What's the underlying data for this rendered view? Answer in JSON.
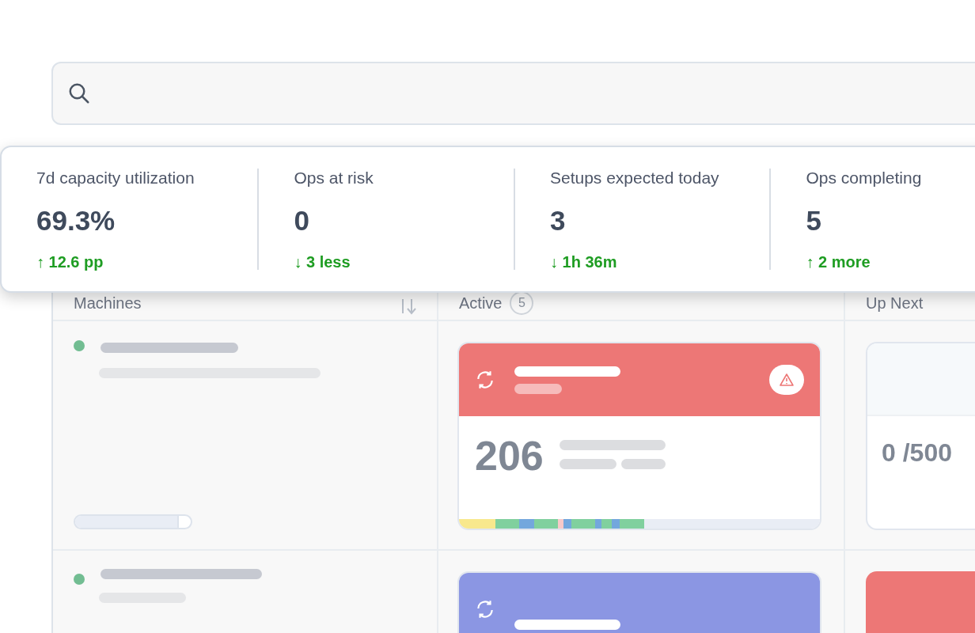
{
  "kpis": [
    {
      "label": "7d capacity utilization",
      "value": "69.3%",
      "delta": "↑ 12.6 pp"
    },
    {
      "label": "Ops at risk",
      "value": "0",
      "delta": "↓ 3 less"
    },
    {
      "label": "Setups expected today",
      "value": "3",
      "delta": "↓ 1h 36m"
    },
    {
      "label": "Ops completing",
      "value": "5",
      "delta": "↑ 2 more"
    }
  ],
  "columns": [
    {
      "title": "Machines",
      "sortable": true
    },
    {
      "title": "Active",
      "count": "5"
    },
    {
      "title": "Up Next"
    }
  ],
  "rows": [
    {
      "progress": {
        "level": 0.9
      },
      "active": {
        "color": "#ed7776",
        "alert": true,
        "value": "206"
      },
      "next": {
        "color": "#f6f9fb",
        "value": "0 /500"
      }
    },
    {
      "active": {
        "color": "#8b96e3",
        "alert": false
      },
      "next": {
        "color": "#ed7776"
      }
    }
  ]
}
